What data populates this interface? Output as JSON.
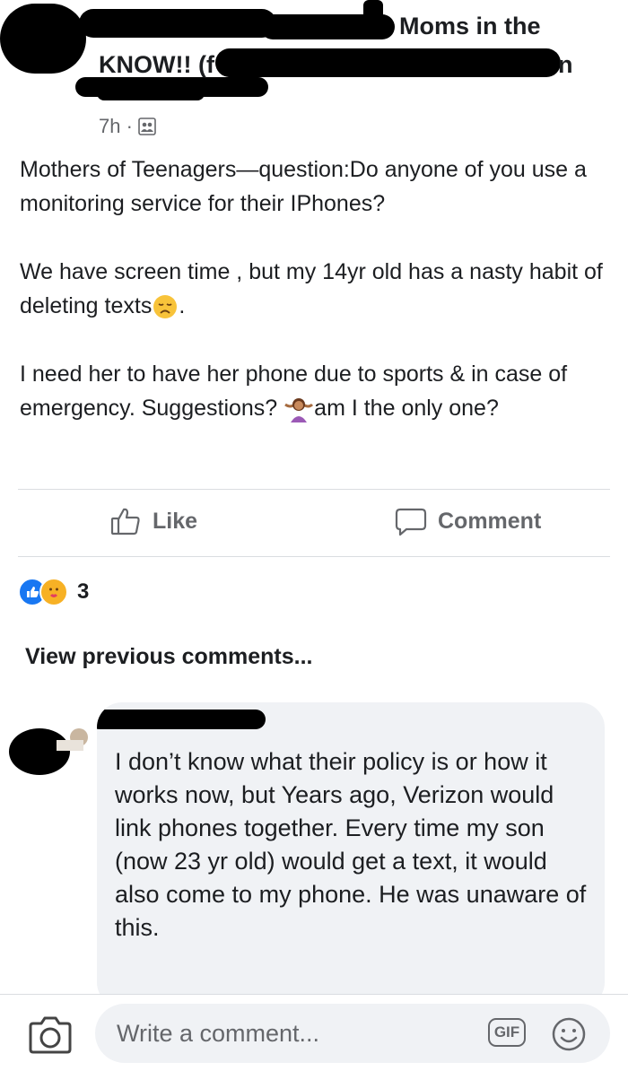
{
  "post": {
    "group_name_line1": "Moms in the",
    "group_name_line2": "KNOW!! (f",
    "group_name_tail": "n",
    "timestamp": "7h ·",
    "privacy_icon": "group-members-icon",
    "paragraphs": [
      "Mothers of Teenagers—question:Do anyone of you use a monitoring service for their IPhones?",
      "We have screen time , but my 14yr old has a nasty habit of deleting texts",
      "I need her to have her phone due to sports & in case of emergency. Suggestions?"
    ],
    "para2_end": ".",
    "para3_tail": "am I the only one?",
    "emoji_sad": "disappointed-face-emoji",
    "emoji_shrug": "woman-shrugging-emoji"
  },
  "actions": {
    "like_label": "Like",
    "comment_label": "Comment"
  },
  "reactions": {
    "count": "3",
    "types": [
      "like",
      "care"
    ],
    "colors": {
      "like": "#1877f2",
      "care": "#f7b125"
    }
  },
  "comments": {
    "view_previous": "View previous comments...",
    "items": [
      {
        "text": "I don’t know what their policy is or how it works now, but Years ago, Verizon would link phones together. Every time my son (now 23 yr old) would get a text, it would also come to my phone. He was unaware of this."
      }
    ]
  },
  "composer": {
    "placeholder": "Write a comment...",
    "gif_label": "GIF",
    "camera_icon": "camera-icon",
    "emoji_icon": "smiley-icon"
  }
}
